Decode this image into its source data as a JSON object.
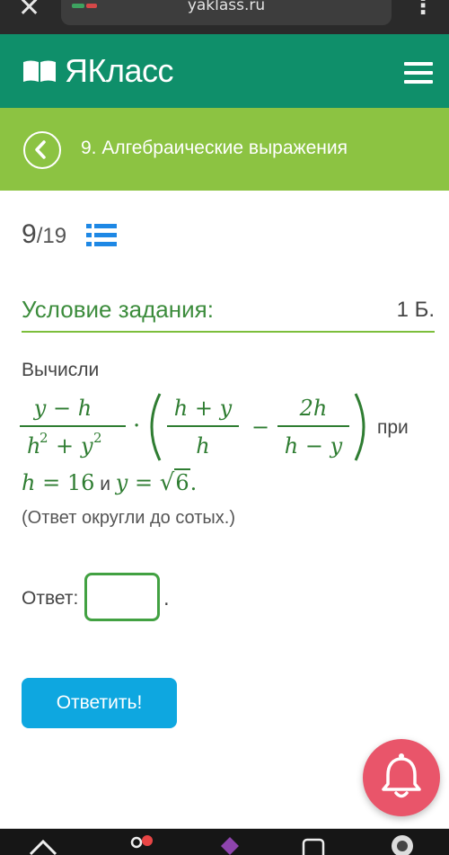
{
  "browser": {
    "url": "yaklass.ru",
    "close_icon": "close-icon",
    "menu_icon": "more-vertical-icon"
  },
  "app": {
    "logo_text": "ЯКласс",
    "logo_icon": "open-book-icon",
    "menu_icon": "hamburger-icon"
  },
  "topic": {
    "title": "9. Алгебраические выражения",
    "back_icon": "chevron-left-icon"
  },
  "progress": {
    "current": "9",
    "total": "/19",
    "list_icon": "list-icon"
  },
  "condition": {
    "title": "Условие задания:",
    "points": "1 Б.",
    "verb": "Вычисли",
    "formula": {
      "f1_num": "y − h",
      "f1_den_h": "h",
      "f1_den_exp": "2",
      "f1_den_plus": "+",
      "f1_den_y": "y",
      "dot": "·",
      "f2_num": "h + y",
      "f2_den": "h",
      "minus": "−",
      "f3_num": "2h",
      "f3_den": "h − y",
      "pri": "при"
    },
    "line2": {
      "var_h": "h",
      "eq1": " = ",
      "val_h": "16",
      "and": " и ",
      "var_y": "y",
      "eq2": " = ",
      "sqrt_sign": "√",
      "radicand": "6",
      "end": "."
    },
    "hint": "(Ответ округли до сотых.)"
  },
  "answer": {
    "label": "Ответ:",
    "value": "",
    "dot": "."
  },
  "submit": {
    "label": "Ответить!"
  },
  "notifications": {
    "icon": "bell-icon"
  },
  "colors": {
    "header": "#0f8f6a",
    "topic_bar": "#8cc342",
    "accent_green": "#2f7d32",
    "submit": "#0ea7e0",
    "bell": "#e9556a"
  }
}
